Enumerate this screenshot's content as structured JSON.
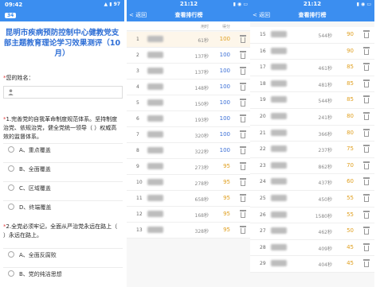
{
  "quiz": {
    "status_time": "09:42",
    "status_icons": "▲ ▮ 97",
    "badge": "34",
    "title": "昆明市疾病预防控制中心健教党支部主题教育理论学习效果测评（10月）",
    "name_question": "您的姓名：",
    "name_icon": "person-icon",
    "q1": "1.完善党的自我革命制度规范体系。坚持制度治党、依规治党，健全党统一领导（ ）权威高效的监督体系。",
    "q1_options": [
      "A、重点覆盖",
      "B、全面覆盖",
      "C、区域覆盖",
      "D、终端覆盖"
    ],
    "q2": "2.全党必须牢记，全面从严治党永远在路上（ ）永远在路上。",
    "q2_options": [
      "A、全面反腐败",
      "B、党的纯洁思想"
    ]
  },
  "ranking_left": {
    "status_time": "21:12",
    "status_icons": "▮ ◉ ▭",
    "back_label": "< 返回",
    "title": "查看排行榜",
    "headers": [
      "",
      "用时",
      "得分",
      ""
    ],
    "rows": [
      {
        "rank": "1",
        "time": "61秒",
        "score": "100",
        "highlight": true
      },
      {
        "rank": "2",
        "time": "137秒",
        "score": "100",
        "highlight": false
      },
      {
        "rank": "3",
        "time": "137秒",
        "score": "100",
        "highlight": false
      },
      {
        "rank": "4",
        "time": "148秒",
        "score": "100",
        "highlight": false
      },
      {
        "rank": "5",
        "time": "150秒",
        "score": "100",
        "highlight": false
      },
      {
        "rank": "6",
        "time": "193秒",
        "score": "100",
        "highlight": false
      },
      {
        "rank": "7",
        "time": "320秒",
        "score": "100",
        "highlight": false
      },
      {
        "rank": "8",
        "time": "322秒",
        "score": "100",
        "highlight": false
      },
      {
        "rank": "9",
        "time": "273秒",
        "score": "95",
        "highlight": false
      },
      {
        "rank": "10",
        "time": "278秒",
        "score": "95",
        "highlight": false
      },
      {
        "rank": "11",
        "time": "658秒",
        "score": "95",
        "highlight": false
      },
      {
        "rank": "12",
        "time": "168秒",
        "score": "95",
        "highlight": false
      },
      {
        "rank": "13",
        "time": "328秒",
        "score": "95",
        "highlight": false
      }
    ]
  },
  "ranking_right": {
    "status_time": "21:12",
    "status_icons": "▮ ◉ ▭",
    "back_label": "< 返回",
    "title": "查看排行榜",
    "rows": [
      {
        "rank": "15",
        "time": "544秒",
        "score": "90"
      },
      {
        "rank": "16",
        "time": "",
        "score": "90"
      },
      {
        "rank": "17",
        "time": "461秒",
        "score": "85"
      },
      {
        "rank": "18",
        "time": "481秒",
        "score": "85"
      },
      {
        "rank": "19",
        "time": "544秒",
        "score": "85"
      },
      {
        "rank": "20",
        "time": "241秒",
        "score": "80"
      },
      {
        "rank": "21",
        "time": "366秒",
        "score": "80"
      },
      {
        "rank": "22",
        "time": "237秒",
        "score": "75"
      },
      {
        "rank": "23",
        "time": "862秒",
        "score": "70"
      },
      {
        "rank": "24",
        "time": "437秒",
        "score": "60"
      },
      {
        "rank": "25",
        "time": "450秒",
        "score": "55"
      },
      {
        "rank": "26",
        "time": "1580秒",
        "score": "55"
      },
      {
        "rank": "27",
        "time": "462秒",
        "score": "50"
      },
      {
        "rank": "28",
        "time": "409秒",
        "score": "45"
      },
      {
        "rank": "29",
        "time": "404秒",
        "score": "45"
      }
    ]
  },
  "colors": {
    "accent": "#3b8ef0",
    "score_top": "#e0a020",
    "score_blue": "#3b6fd6",
    "title": "#2f6fd6"
  }
}
